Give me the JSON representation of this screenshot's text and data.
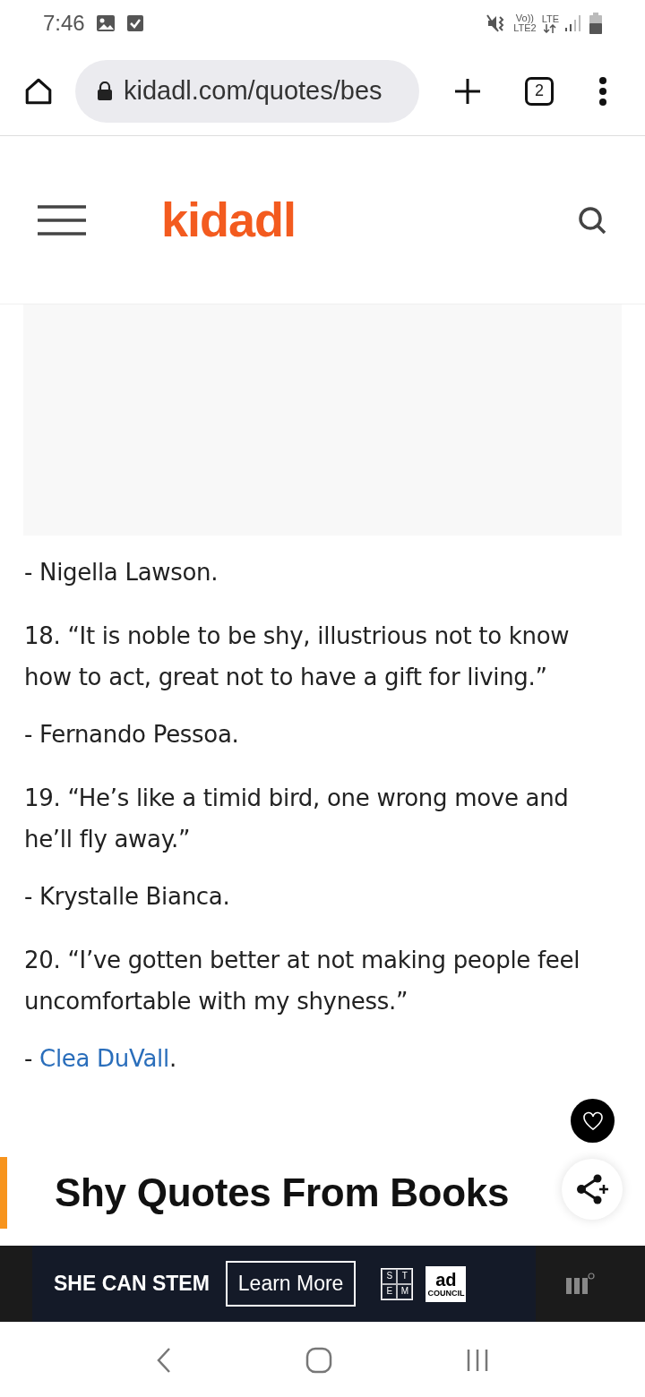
{
  "status_bar": {
    "time": "7:46",
    "volte": "Vo))",
    "lte2": "LTE2",
    "lte": "LTE"
  },
  "browser": {
    "url": "kidadl.com/quotes/bes",
    "tab_count": "2"
  },
  "site": {
    "logo": "kidadl"
  },
  "content": [
    {
      "kind": "author",
      "text": "- Nigella Lawson."
    },
    {
      "kind": "quote",
      "text": "18. “It is noble to be shy, illustrious not to know how to act, great not to have a gift for living.”"
    },
    {
      "kind": "author",
      "text": "- Fernando Pessoa."
    },
    {
      "kind": "quote",
      "text": "19. “He’s like a timid bird, one wrong move and he’ll fly away.”"
    },
    {
      "kind": "author",
      "text": "- Krystalle Bianca."
    },
    {
      "kind": "quote",
      "text": "20. “I’ve gotten better at not making people feel uncomfortable with my shyness.”"
    },
    {
      "kind": "author_link",
      "prefix": "- ",
      "link": "Clea DuVall",
      "suffix": "."
    }
  ],
  "heading": "Shy Quotes From Books",
  "ad": {
    "headline": "SHE CAN STEM",
    "button": "Learn More",
    "stem_letters": [
      "S",
      "T",
      "E",
      "M"
    ],
    "logo_big": "ad",
    "logo_small": "COUNCIL"
  }
}
